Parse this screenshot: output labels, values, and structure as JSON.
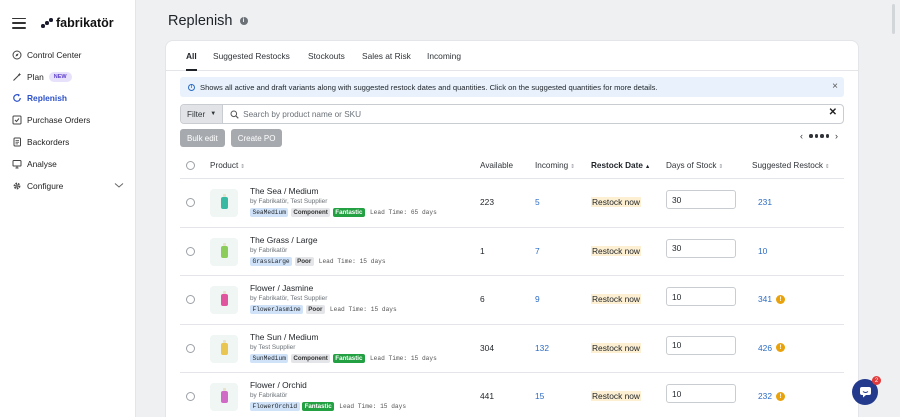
{
  "brand": {
    "name": "fabrikatör"
  },
  "sidebar": {
    "items": [
      {
        "label": "Control Center",
        "icon": "compass-icon"
      },
      {
        "label": "Plan",
        "icon": "wand-icon",
        "badge": "NEW"
      },
      {
        "label": "Replenish",
        "icon": "refresh-icon",
        "active": true
      },
      {
        "label": "Purchase Orders",
        "icon": "checkbox-icon"
      },
      {
        "label": "Backorders",
        "icon": "document-icon"
      },
      {
        "label": "Analyse",
        "icon": "monitor-icon"
      },
      {
        "label": "Configure",
        "icon": "gear-icon",
        "expandable": true
      }
    ]
  },
  "page": {
    "title": "Replenish"
  },
  "tabs": [
    {
      "label": "All",
      "active": true
    },
    {
      "label": "Suggested Restocks"
    },
    {
      "label": "Stockouts"
    },
    {
      "label": "Sales at Risk"
    },
    {
      "label": "Incoming"
    }
  ],
  "banner": {
    "text": "Shows all active and draft variants along with suggested restock dates and quantities. Click on the suggested quantities for more details."
  },
  "search": {
    "filter_label": "Filter",
    "placeholder": "Search by product name or SKU"
  },
  "actions": {
    "bulk_edit": "Bulk edit",
    "create_po": "Create PO"
  },
  "table": {
    "headers": {
      "product": "Product",
      "available": "Available",
      "incoming": "Incoming",
      "restock_date": "Restock Date",
      "days_of_stock": "Days of Stock",
      "suggested_restock": "Suggested Restock"
    },
    "rows": [
      {
        "name": "The Sea / Medium",
        "supplier": "by Fabrikatör, Test Supplier",
        "sku": "SeaMedium",
        "tags": [
          "Component",
          "Fantastic"
        ],
        "lead": "Lead Time: 65 days",
        "available": "223",
        "incoming": "5",
        "restock": "Restock now",
        "days": "30",
        "suggested": "231",
        "warning": false,
        "bottle_color": "#37b9a4"
      },
      {
        "name": "The Grass / Large",
        "supplier": "by Fabrikatör",
        "sku": "GrassLarge",
        "tags": [
          "Poor"
        ],
        "lead": "Lead Time: 15 days",
        "available": "1",
        "incoming": "7",
        "restock": "Restock now",
        "days": "30",
        "suggested": "10",
        "warning": false,
        "bottle_color": "#8ccc5a"
      },
      {
        "name": "Flower / Jasmine",
        "supplier": "by Fabrikatör, Test Supplier",
        "sku": "FlowerJasmine",
        "tags": [
          "Poor"
        ],
        "lead": "Lead Time: 15 days",
        "available": "6",
        "incoming": "9",
        "restock": "Restock now",
        "days": "10",
        "suggested": "341",
        "warning": true,
        "bottle_color": "#e0559d"
      },
      {
        "name": "The Sun / Medium",
        "supplier": "by Test Supplier",
        "sku": "SunMedium",
        "tags": [
          "Component",
          "Fantastic"
        ],
        "lead": "Lead Time: 15 days",
        "available": "304",
        "incoming": "132",
        "restock": "Restock now",
        "days": "10",
        "suggested": "426",
        "warning": true,
        "bottle_color": "#e9c552"
      },
      {
        "name": "Flower / Orchid",
        "supplier": "by Fabrikatör",
        "sku": "FlowerOrchid",
        "tags": [
          "Fantastic"
        ],
        "lead": "Lead Time: 15 days",
        "available": "441",
        "incoming": "15",
        "restock": "Restock now",
        "days": "10",
        "suggested": "232",
        "warning": true,
        "bottle_color": "#d06ac6"
      }
    ]
  },
  "chat": {
    "count": "2"
  },
  "colors": {
    "accent": "#2b50c8",
    "link": "#2b6cc4",
    "fantastic": "#23a042",
    "warning": "#e8a20b"
  }
}
